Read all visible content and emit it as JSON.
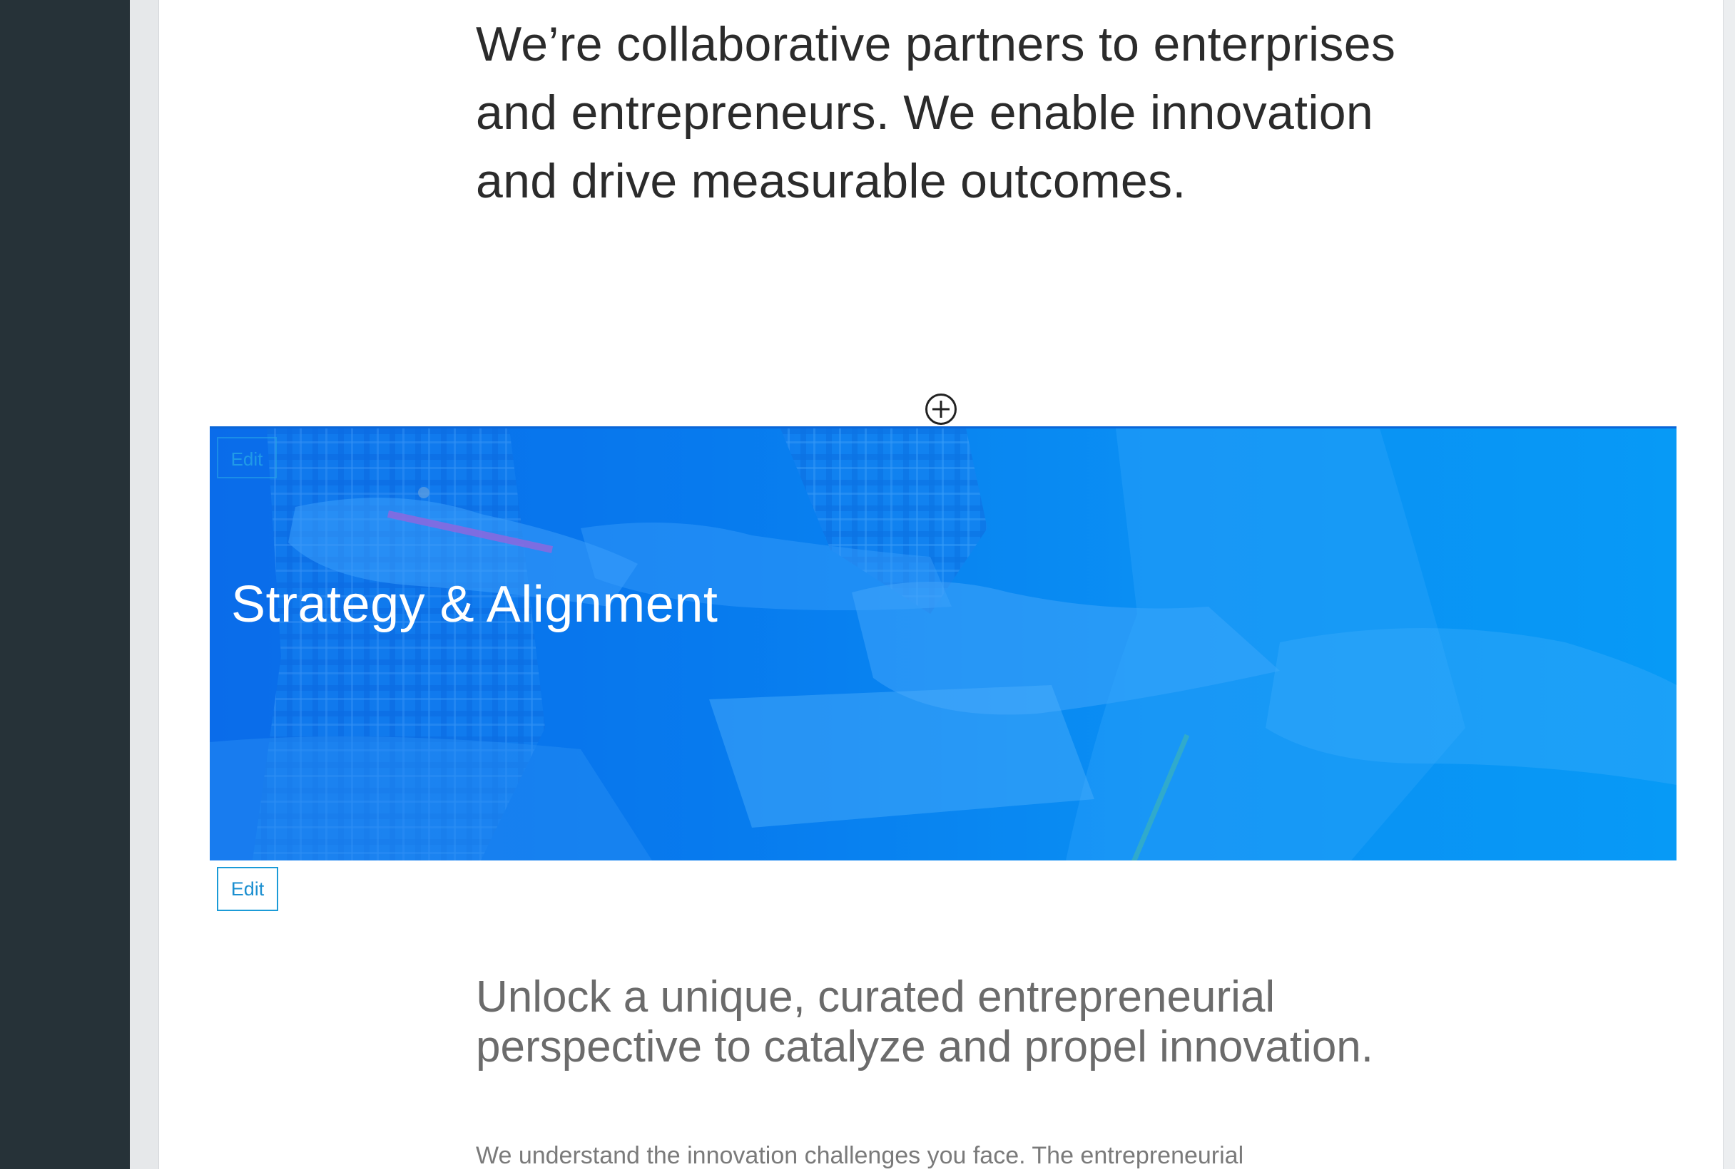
{
  "intro": {
    "text": "We’re collaborative partners to enterprises and entrepreneurs. We enable innovation and drive measurable outcomes."
  },
  "add_section": {
    "icon": "plus-circle-icon"
  },
  "hero": {
    "title": "Strategy & Alignment",
    "overlay_color": "#0a86f0",
    "edit_label": "Edit"
  },
  "edit_button": {
    "label": "Edit"
  },
  "section": {
    "heading": "Unlock a unique, curated entrepreneurial perspective to catalyze and propel innovation.",
    "body": "We understand the innovation challenges you face. The entrepreneurial"
  },
  "colors": {
    "sidebar": "#263238",
    "accent": "#1b9bd7",
    "text_primary": "#2b2b2b",
    "text_secondary": "#6b6b6b"
  }
}
